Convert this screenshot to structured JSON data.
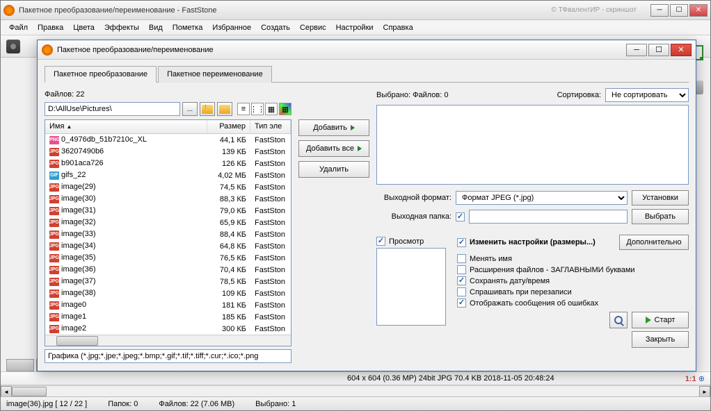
{
  "main_window": {
    "title": "Пакетное преобразование/переименование - FastStone",
    "bg_title": "© ТФвалентИР - скриншот"
  },
  "menubar": [
    "Файл",
    "Правка",
    "Цвета",
    "Эффекты",
    "Вид",
    "Пометка",
    "Избранное",
    "Создать",
    "Сервис",
    "Настройки",
    "Справка"
  ],
  "dialog": {
    "title": "Пакетное преобразование/переименование",
    "tabs": [
      "Пакетное преобразование",
      "Пакетное переименование"
    ],
    "active_tab": 0,
    "file_count_label": "Файлов: 22",
    "path": "D:\\AllUse\\Pictures\\",
    "columns": {
      "name": "Имя",
      "size": "Размер",
      "type": "Тип эле"
    },
    "files": [
      {
        "icon": "png",
        "name": "0_4976db_51b7210c_XL",
        "size": "44,1 КБ",
        "type": "FastSton"
      },
      {
        "icon": "jpg",
        "name": "36207490b6",
        "size": "139 КБ",
        "type": "FastSton"
      },
      {
        "icon": "jpg",
        "name": "b901aca726",
        "size": "126 КБ",
        "type": "FastSton"
      },
      {
        "icon": "gif",
        "name": "gifs_22",
        "size": "4,02 МБ",
        "type": "FastSton"
      },
      {
        "icon": "jpg",
        "name": "image(29)",
        "size": "74,5 КБ",
        "type": "FastSton"
      },
      {
        "icon": "jpg",
        "name": "image(30)",
        "size": "88,3 КБ",
        "type": "FastSton"
      },
      {
        "icon": "jpg",
        "name": "image(31)",
        "size": "79,0 КБ",
        "type": "FastSton"
      },
      {
        "icon": "jpg",
        "name": "image(32)",
        "size": "65,9 КБ",
        "type": "FastSton"
      },
      {
        "icon": "jpg",
        "name": "image(33)",
        "size": "88,4 КБ",
        "type": "FastSton"
      },
      {
        "icon": "jpg",
        "name": "image(34)",
        "size": "64,8 КБ",
        "type": "FastSton"
      },
      {
        "icon": "jpg",
        "name": "image(35)",
        "size": "76,5 КБ",
        "type": "FastSton"
      },
      {
        "icon": "jpg",
        "name": "image(36)",
        "size": "70,4 КБ",
        "type": "FastSton"
      },
      {
        "icon": "jpg",
        "name": "image(37)",
        "size": "78,5 КБ",
        "type": "FastSton"
      },
      {
        "icon": "jpg",
        "name": "image(38)",
        "size": "109 КБ",
        "type": "FastSton"
      },
      {
        "icon": "jpg",
        "name": "image0",
        "size": "181 КБ",
        "type": "FastSton"
      },
      {
        "icon": "jpg",
        "name": "image1",
        "size": "185 КБ",
        "type": "FastSton"
      },
      {
        "icon": "jpg",
        "name": "image2",
        "size": "300 КБ",
        "type": "FastSton"
      }
    ],
    "filter": "Графика (*.jpg;*.jpe;*.jpeg;*.bmp;*.gif;*.tif;*.tiff;*.cur;*.ico;*.png",
    "buttons": {
      "add": "Добавить",
      "add_all": "Добавить все",
      "remove": "Удалить",
      "browse_path": "...",
      "settings": "Установки",
      "browse_folder": "Выбрать",
      "advanced": "Дополнительно",
      "start": "Старт",
      "close": "Закрыть"
    },
    "selected_label": "Выбрано: Файлов: 0",
    "sort_label": "Сортировка:",
    "sort_value": "Не сортировать",
    "format_label": "Выходной формат:",
    "format_value": "Формат JPEG (*.jpg)",
    "folder_label": "Выходная папка:",
    "folder_value": "",
    "preview_label": "Просмотр",
    "opt_header": "Изменить настройки (размеры...)",
    "options": [
      {
        "label": "Менять имя",
        "checked": false
      },
      {
        "label": "Расширения файлов - ЗАГЛАВНЫМИ буквами",
        "checked": false
      },
      {
        "label": "Сохранять дату/время",
        "checked": true
      },
      {
        "label": "Спрашивать при перезаписи",
        "checked": false
      },
      {
        "label": "Отображать сообщения об ошибках",
        "checked": true
      }
    ]
  },
  "infobar": {
    "info": "604 x 604 (0.36 MP)   24bit  JPG   70.4 KB   2018-11-05 20:48:24",
    "ratio": "1:1"
  },
  "statusbar": {
    "file": "image(36).jpg [ 12 / 22 ]",
    "folders": "Папок: 0",
    "files": "Файлов: 22 (7.06 MB)",
    "selected": "Выбрано: 1"
  }
}
